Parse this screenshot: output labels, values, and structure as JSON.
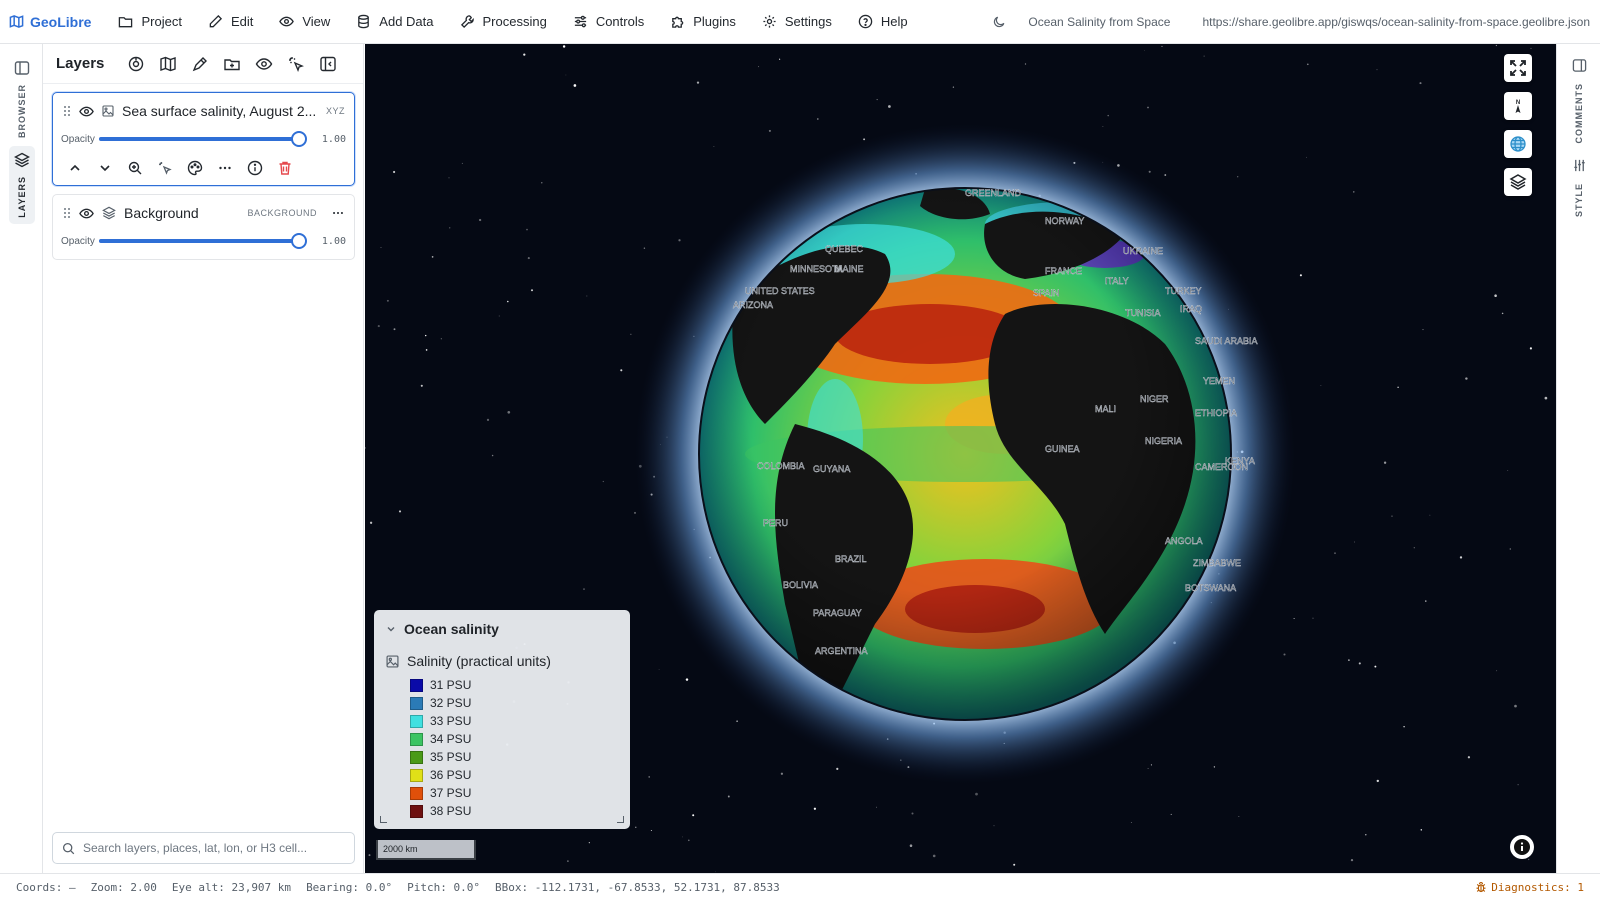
{
  "app": {
    "name": "GeoLibre"
  },
  "menu": [
    {
      "label": "Project",
      "icon": "folder-icon"
    },
    {
      "label": "Edit",
      "icon": "pencil-icon"
    },
    {
      "label": "View",
      "icon": "eye-icon"
    },
    {
      "label": "Add Data",
      "icon": "database-icon"
    },
    {
      "label": "Processing",
      "icon": "wrench-icon"
    },
    {
      "label": "Controls",
      "icon": "sliders-icon"
    },
    {
      "label": "Plugins",
      "icon": "puzzle-icon"
    },
    {
      "label": "Settings",
      "icon": "gear-icon"
    },
    {
      "label": "Help",
      "icon": "help-circle-icon"
    }
  ],
  "project": {
    "title": "Ocean Salinity from Space",
    "url": "https://share.geolibre.app/giswqs/ocean-salinity-from-space.geolibre.json"
  },
  "left_rail": {
    "browser_label": "BROWSER",
    "layers_label": "LAYERS"
  },
  "right_rail": {
    "comments_label": "COMMENTS",
    "style_label": "STYLE"
  },
  "layers_panel": {
    "title": "Layers",
    "opacity_label": "Opacity",
    "layers": [
      {
        "name": "Sea surface salinity, August 2...",
        "type": "XYZ",
        "opacity": 1.0,
        "opacity_text": "1.00",
        "selected": true
      },
      {
        "name": "Background",
        "type": "BACKGROUND",
        "opacity": 1.0,
        "opacity_text": "1.00",
        "selected": false
      }
    ],
    "search_placeholder": "Search layers, places, lat, lon, or H3 cell..."
  },
  "legend": {
    "title": "Ocean salinity",
    "subtitle": "Salinity (practical units)",
    "items": [
      {
        "label": "31 PSU",
        "color": "#0a0aa8"
      },
      {
        "label": "32 PSU",
        "color": "#2b7bb6"
      },
      {
        "label": "33 PSU",
        "color": "#3fe0e0"
      },
      {
        "label": "34 PSU",
        "color": "#3cc463"
      },
      {
        "label": "35 PSU",
        "color": "#4a9a18"
      },
      {
        "label": "36 PSU",
        "color": "#e0e018"
      },
      {
        "label": "37 PSU",
        "color": "#e0500a"
      },
      {
        "label": "38 PSU",
        "color": "#6e1010"
      }
    ]
  },
  "map": {
    "scale_label": "2000 km",
    "north_label": "N",
    "place_labels": [
      "GREENLAND",
      "QUEBEC",
      "UNITED STATES",
      "ARIZONA",
      "NORWAY",
      "UKRAINE",
      "FRANCE",
      "SPAIN",
      "ITALY",
      "TURKEY",
      "TUNISIA",
      "IRAQ",
      "SAUDI ARABIA",
      "YEMEN",
      "ETHIOPIA",
      "NIGER",
      "MALI",
      "NIGERIA",
      "CAMEROON",
      "KENYA",
      "GUINEA",
      "GUYANA",
      "COLOMBIA",
      "PERU",
      "BRAZIL",
      "BOLIVIA",
      "PARAGUAY",
      "ARGENTINA",
      "ANGOLA",
      "ZIMBABWE",
      "BOTSWANA",
      "MINNESOTA",
      "MAINE"
    ]
  },
  "status": {
    "coords": "Coords: —",
    "zoom": "Zoom: 2.00",
    "eye_alt": "Eye alt: 23,907 km",
    "bearing": "Bearing: 0.0°",
    "pitch": "Pitch: 0.0°",
    "bbox": "BBox: -112.1731, -67.8533, 52.1731, 87.8533",
    "diagnostics": "Diagnostics: 1"
  },
  "colors": {
    "accent": "#2f6fd6",
    "danger": "#e5484d",
    "warning": "#b35900"
  }
}
